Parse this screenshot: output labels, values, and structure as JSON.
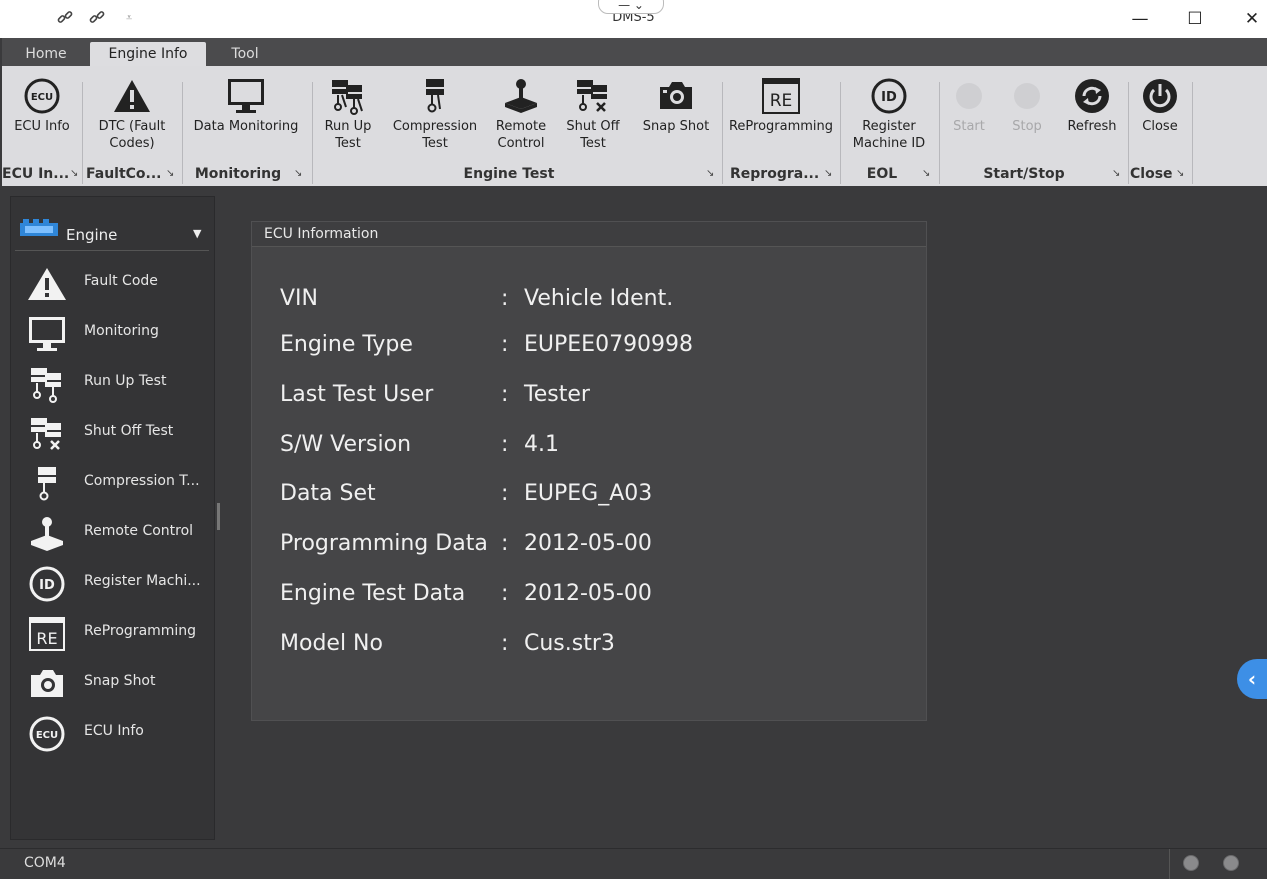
{
  "window": {
    "title": "DMS-5",
    "quick_access": [
      "link-icon",
      "link-icon",
      "customize-icon"
    ],
    "controls": {
      "minimize": "—",
      "maximize": "☐",
      "close": "✕"
    },
    "drop_tab": "— ⌄"
  },
  "tabs": [
    {
      "label": "Home",
      "active": false
    },
    {
      "label": "Engine Info",
      "active": true
    },
    {
      "label": "Tool",
      "active": false
    }
  ],
  "ribbon": {
    "buttons": [
      {
        "label": "ECU Info",
        "icon": "ecu-icon",
        "enabled": true
      },
      {
        "label": "DTC (Fault Codes)",
        "icon": "warning-icon",
        "enabled": true
      },
      {
        "label": "Data Monitoring",
        "icon": "monitor-icon",
        "enabled": true
      },
      {
        "label": "Run Up Test",
        "icon": "run-up-icon",
        "enabled": true
      },
      {
        "label": "Compression Test",
        "icon": "compression-icon",
        "enabled": true
      },
      {
        "label": "Remote Control",
        "icon": "joystick-icon",
        "enabled": true
      },
      {
        "label": "Shut Off Test",
        "icon": "shut-off-icon",
        "enabled": true
      },
      {
        "label": "Snap Shot",
        "icon": "camera-icon",
        "enabled": true
      },
      {
        "label": "ReProgramming",
        "icon": "reprogram-icon",
        "enabled": true
      },
      {
        "label": "Register Machine ID",
        "icon": "id-icon",
        "enabled": true
      },
      {
        "label": "Start",
        "icon": "start-icon",
        "enabled": false
      },
      {
        "label": "Stop",
        "icon": "stop-icon",
        "enabled": false
      },
      {
        "label": "Refresh",
        "icon": "refresh-icon",
        "enabled": true
      },
      {
        "label": "Close",
        "icon": "power-icon",
        "enabled": true
      }
    ],
    "groups": [
      "ECU In...",
      "FaultCo...",
      "Monitoring",
      "Engine Test",
      "Reprogra...",
      "EOL",
      "Start/Stop",
      "Close"
    ],
    "group_arrow": "↘"
  },
  "sidebar": {
    "selector": {
      "label": "Engine",
      "arrow": "▼"
    },
    "items": [
      {
        "label": "Fault Code",
        "icon": "warning-icon"
      },
      {
        "label": "Monitoring",
        "icon": "monitor-icon"
      },
      {
        "label": "Run Up Test",
        "icon": "run-up-icon"
      },
      {
        "label": "Shut Off Test",
        "icon": "shut-off-icon"
      },
      {
        "label": "Compression T...",
        "icon": "compression-icon"
      },
      {
        "label": "Remote Control",
        "icon": "joystick-icon"
      },
      {
        "label": "Register Machi...",
        "icon": "id-icon"
      },
      {
        "label": "ReProgramming",
        "icon": "reprogram-icon"
      },
      {
        "label": "Snap Shot",
        "icon": "camera-icon"
      },
      {
        "label": "ECU Info",
        "icon": "ecu-icon"
      }
    ]
  },
  "panel": {
    "title": "ECU Information",
    "separator": ":",
    "fields": [
      {
        "label": "VIN",
        "value": "Vehicle Ident."
      },
      {
        "label": "Engine Type",
        "value": "EUPEE0790998"
      },
      {
        "label": "Last Test User",
        "value": "Tester"
      },
      {
        "label": "S/W Version",
        "value": "4.1"
      },
      {
        "label": "Data Set",
        "value": "EUPEG_A03"
      },
      {
        "label": "Programming Data",
        "value": "2012-05-00"
      },
      {
        "label": "Engine Test Data",
        "value": "2012-05-00"
      },
      {
        "label": "Model No",
        "value": "Cus.str3"
      }
    ]
  },
  "collapse_arrow": "‹",
  "status": {
    "port": "COM4"
  }
}
